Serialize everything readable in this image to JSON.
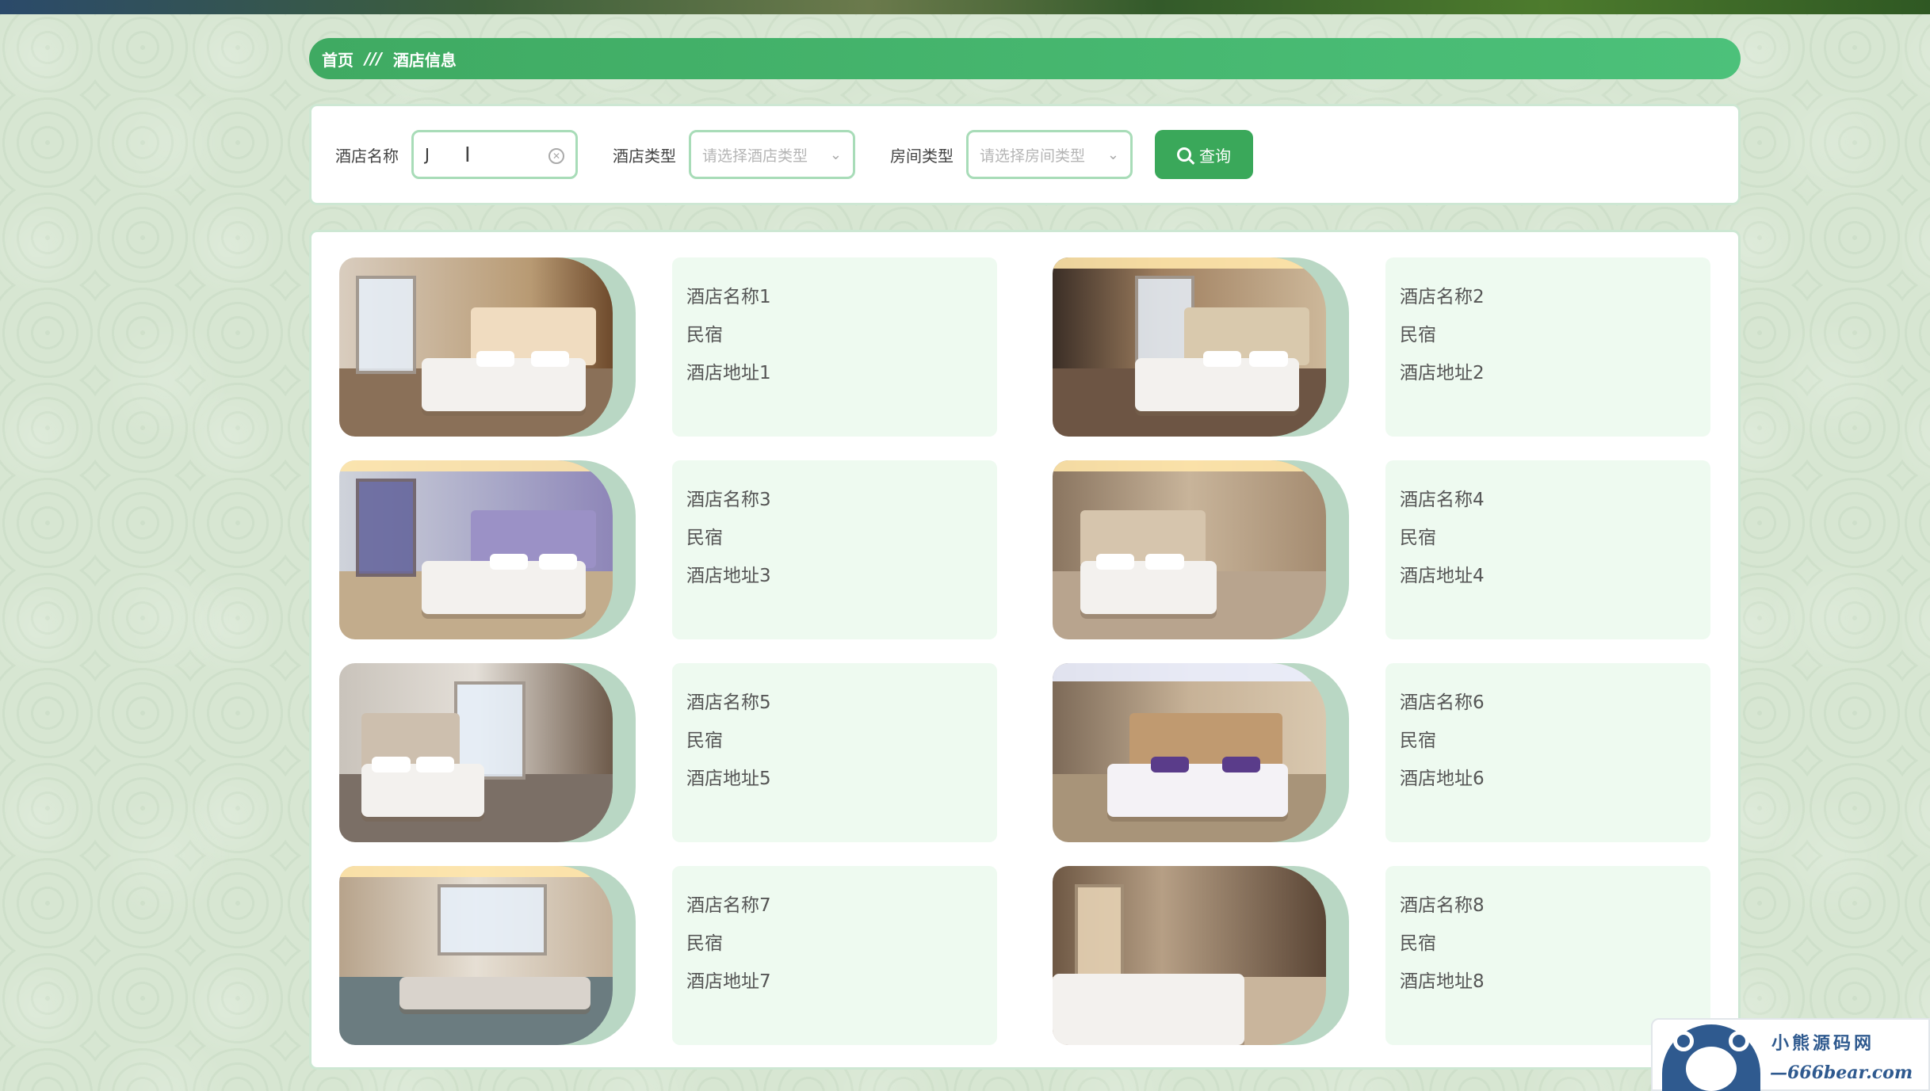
{
  "breadcrumb": {
    "home": "首页",
    "separator": "///",
    "current": "酒店信息"
  },
  "search": {
    "hotel_name_label": "酒店名称",
    "hotel_name_value": "J",
    "hotel_type_label": "酒店类型",
    "hotel_type_placeholder": "请选择酒店类型",
    "room_type_label": "房间类型",
    "room_type_placeholder": "请选择房间类型",
    "query_label": "查询"
  },
  "hotels": [
    {
      "name": "酒店名称1",
      "type": "民宿",
      "address": "酒店地址1"
    },
    {
      "name": "酒店名称2",
      "type": "民宿",
      "address": "酒店地址2"
    },
    {
      "name": "酒店名称3",
      "type": "民宿",
      "address": "酒店地址3"
    },
    {
      "name": "酒店名称4",
      "type": "民宿",
      "address": "酒店地址4"
    },
    {
      "name": "酒店名称5",
      "type": "民宿",
      "address": "酒店地址5"
    },
    {
      "name": "酒店名称6",
      "type": "民宿",
      "address": "酒店地址6"
    },
    {
      "name": "酒店名称7",
      "type": "民宿",
      "address": "酒店地址7"
    },
    {
      "name": "酒店名称8",
      "type": "民宿",
      "address": "酒店地址8"
    }
  ],
  "watermark": {
    "title": "小熊源码网",
    "url": "—666bear.com—"
  },
  "colors": {
    "accent": "#3aa85a",
    "card_bg": "#eefaf0",
    "page_bg": "#d7e6d2"
  }
}
